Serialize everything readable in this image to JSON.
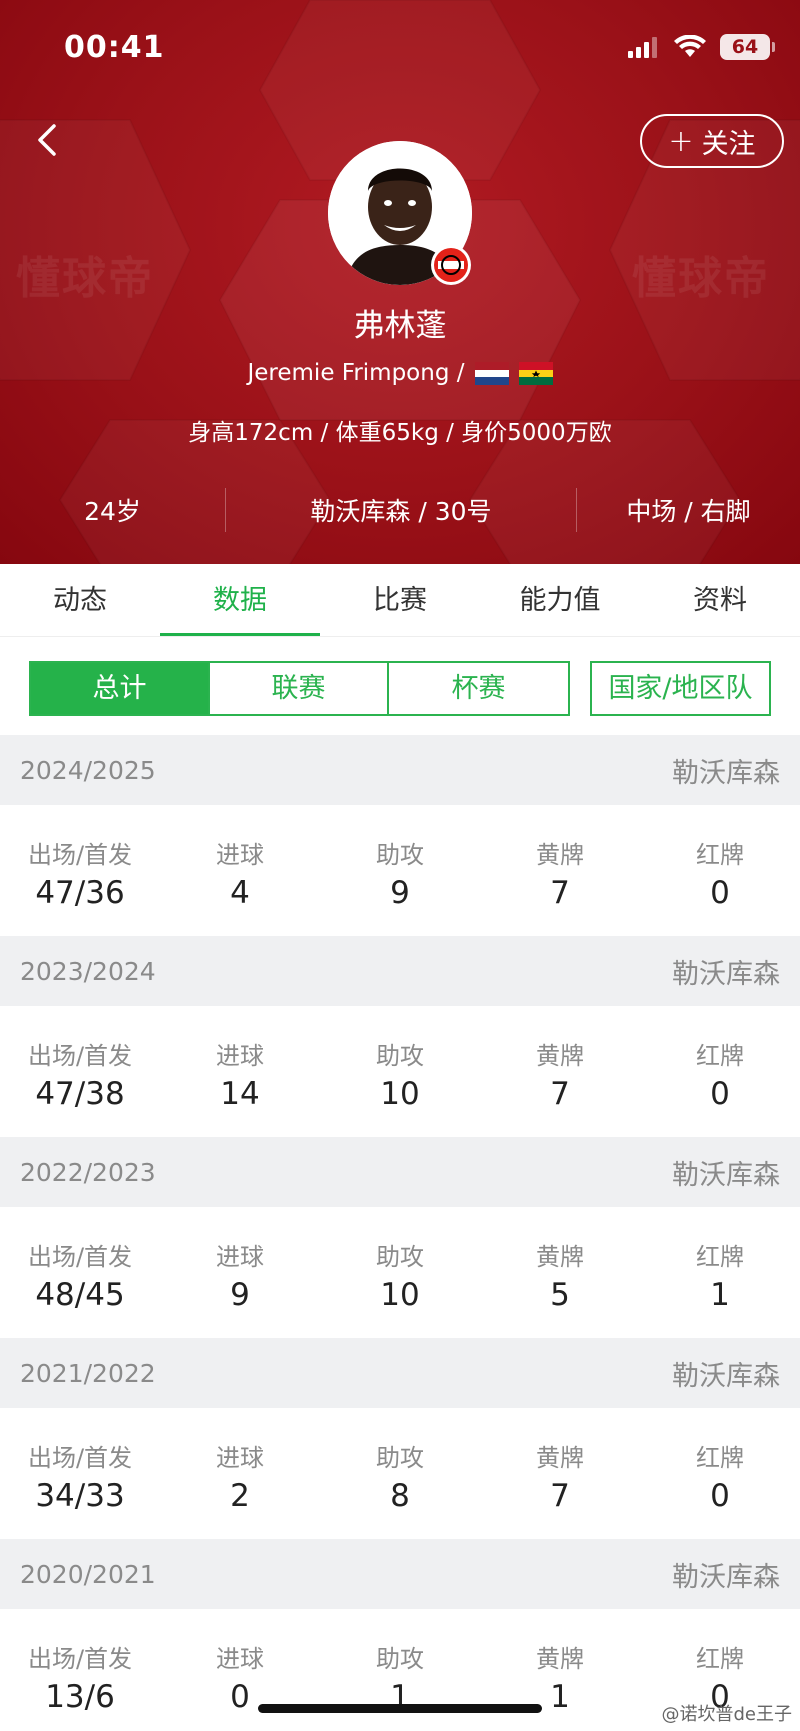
{
  "status_bar": {
    "time": "00:41",
    "battery": "64"
  },
  "header": {
    "watermark_text": "懂球帝",
    "follow_label": "关注",
    "follow_plus": "+",
    "player_name_cn": "弗林蓬",
    "player_name_en": "Jeremie Frimpong /",
    "body_stats": "身高172cm / 体重65kg / 身价5000万欧",
    "age": "24岁",
    "club_number": "勒沃库森 / 30号",
    "position_foot": "中场 / 右脚",
    "flags": [
      "netherlands-flag",
      "ghana-flag"
    ],
    "colors": {
      "bg": "#9a1118",
      "accent": "#1fb14a"
    }
  },
  "tabs": [
    "动态",
    "数据",
    "比赛",
    "能力值",
    "资料"
  ],
  "active_tab": 1,
  "filters": {
    "segments": [
      "总计",
      "联赛",
      "杯赛"
    ],
    "national": "国家/地区队",
    "active": 0
  },
  "stat_labels": [
    "出场/首发",
    "进球",
    "助攻",
    "黄牌",
    "红牌"
  ],
  "seasons": [
    {
      "season": "2024/2025",
      "team": "勒沃库森",
      "apps": "47/36",
      "goals": "4",
      "assists": "9",
      "yellow": "7",
      "red": "0"
    },
    {
      "season": "2023/2024",
      "team": "勒沃库森",
      "apps": "47/38",
      "goals": "14",
      "assists": "10",
      "yellow": "7",
      "red": "0"
    },
    {
      "season": "2022/2023",
      "team": "勒沃库森",
      "apps": "48/45",
      "goals": "9",
      "assists": "10",
      "yellow": "5",
      "red": "1"
    },
    {
      "season": "2021/2022",
      "team": "勒沃库森",
      "apps": "34/33",
      "goals": "2",
      "assists": "8",
      "yellow": "7",
      "red": "0"
    },
    {
      "season": "2020/2021",
      "team": "勒沃库森",
      "apps": "13/6",
      "goals": "0",
      "assists": "1",
      "yellow": "1",
      "red": "0"
    }
  ],
  "credit": "@诺坎普de王子"
}
